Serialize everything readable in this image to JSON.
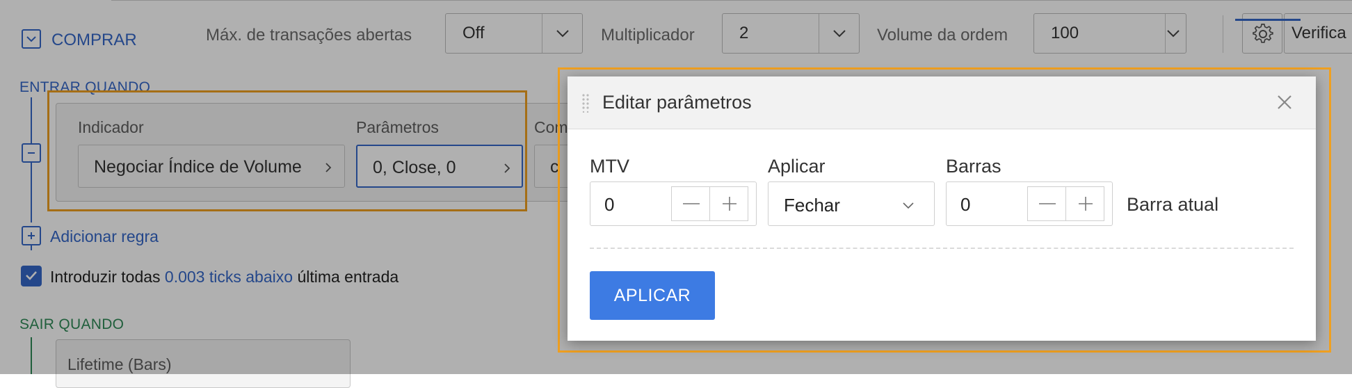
{
  "toolbar": {
    "buy_label": "COMPRAR",
    "max_open_trades_label": "Máx. de transações abertas",
    "max_open_trades_value": "Off",
    "multiplier_label": "Multiplicador",
    "multiplier_value": "2",
    "order_volume_label": "Volume da ordem",
    "order_volume_value": "100",
    "verify_label": "Verifica"
  },
  "entry": {
    "section_title": "ENTRAR QUANDO",
    "indicator_label": "Indicador",
    "indicator_value": "Negociar Índice de Volume",
    "parameters_label": "Parâmetros",
    "parameters_value": "0, Close, 0",
    "compare_label_partial": "Com",
    "compare_value_partial": "c",
    "add_rule_label": "Adicionar regra",
    "enter_all_prefix": "Introduzir todas",
    "enter_all_link": "0.003 ticks abaixo",
    "enter_all_suffix": "última entrada",
    "enter_all_checked": true
  },
  "exit": {
    "section_title": "SAIR QUANDO",
    "lifetime_label": "Lifetime (Bars)"
  },
  "modal": {
    "title": "Editar parâmetros",
    "fields": {
      "mtv_label": "MTV",
      "mtv_value": "0",
      "apply_label": "Aplicar",
      "apply_value": "Fechar",
      "bars_label": "Barras",
      "bars_value": "0",
      "current_bar_label": "Barra atual"
    },
    "apply_button_label": "APLICAR"
  },
  "colors": {
    "accent": "#3567c9",
    "primary_button": "#3d7be3",
    "exit_section": "#2f8a57",
    "highlight": "#f0a020"
  }
}
